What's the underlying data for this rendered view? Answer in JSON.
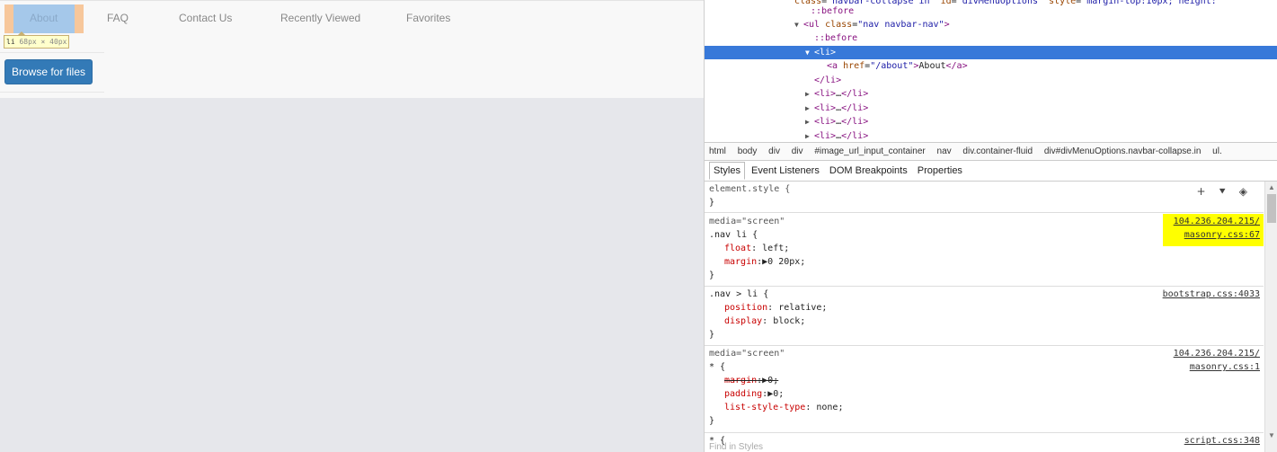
{
  "site_nav": {
    "items": [
      "About",
      "FAQ",
      "Contact Us",
      "Recently Viewed",
      "Favorites"
    ],
    "browse_button": "Browse for files"
  },
  "hover_tooltip": {
    "tag": "li",
    "dims": "68px × 40px"
  },
  "elements_panel": {
    "lines": [
      {
        "html": "<span class=\"attr\">class</span>=<span class=\"val\">\"navbar-collapse in\"</span> <span class=\"attr\">id</span>=<span class=\"val\">\"divMenuOptions\"</span> <span class=\"attr\">style</span>=<span class=\"val\">\"margin-top:10px; height:\"</span>"
      },
      {
        "html": "<span class=\"pseudo\">::before</span>"
      },
      {
        "html": "<span class=\"tri\">▼</span><span class=\"tag\">&lt;ul</span> <span class=\"attr\">class</span>=<span class=\"val\">\"nav navbar-nav\"</span><span class=\"tag\">&gt;</span>"
      },
      {
        "html": "<span class=\"pseudo\">::before</span>"
      },
      {
        "html": "<span class=\"tri\">▼</span><span class=\"tag\">&lt;li&gt;</span>"
      },
      {
        "html": "<span class=\"tag\">&lt;a</span> <span class=\"attr\">href</span>=<span class=\"val\">\"/about\"</span><span class=\"tag\">&gt;</span>About<span class=\"tag\">&lt;/a&gt;</span>"
      },
      {
        "html": "<span class=\"tag\">&lt;/li&gt;</span>"
      },
      {
        "html": "<span class=\"tri\">▶</span><span class=\"tag\">&lt;li&gt;</span>…<span class=\"tag\">&lt;/li&gt;</span>"
      },
      {
        "html": "<span class=\"tri\">▶</span><span class=\"tag\">&lt;li&gt;</span>…<span class=\"tag\">&lt;/li&gt;</span>"
      },
      {
        "html": "<span class=\"tri\">▶</span><span class=\"tag\">&lt;li&gt;</span>…<span class=\"tag\">&lt;/li&gt;</span>"
      },
      {
        "html": "<span class=\"tri\">▶</span><span class=\"tag\">&lt;li&gt;</span>…<span class=\"tag\">&lt;/li&gt;</span>"
      }
    ]
  },
  "breadcrumbs": [
    "html",
    "body",
    "div",
    "div",
    "#image_url_input_container",
    "nav",
    "div.container-fluid",
    "div#divMenuOptions.navbar-collapse.in",
    "ul."
  ],
  "styles_tabs": [
    "Styles",
    "Event Listeners",
    "DOM Breakpoints",
    "Properties"
  ],
  "style_rules": {
    "element_style": "element.style {",
    "close": "}",
    "rule1": {
      "media": "media=\"screen\"",
      "selector": ".nav li {",
      "src1": "104.236.204.215/",
      "src2": "masonry.css:67",
      "p1": "float",
      "v1": "left;",
      "p2": "margin",
      "v2": "▶0 20px;"
    },
    "rule2": {
      "selector": ".nav > li {",
      "src": "bootstrap.css:4033",
      "p1": "position",
      "v1": "relative;",
      "p2": "display",
      "v2": "block;"
    },
    "rule3": {
      "media": "media=\"screen\"",
      "selector": "* {",
      "src1": "104.236.204.215/",
      "src2": "masonry.css:1",
      "p1": "margin",
      "v1": "▶0;",
      "p2": "padding",
      "v2": "▶0;",
      "p3": "list-style-type",
      "v3": "none;"
    },
    "rule4": {
      "selector": "* {",
      "src": "script.css:348"
    },
    "find_placeholder": "Find in Styles"
  },
  "colors": {
    "selection": "#3879d9",
    "highlight": "#ffff00",
    "button": "#337ab7"
  }
}
